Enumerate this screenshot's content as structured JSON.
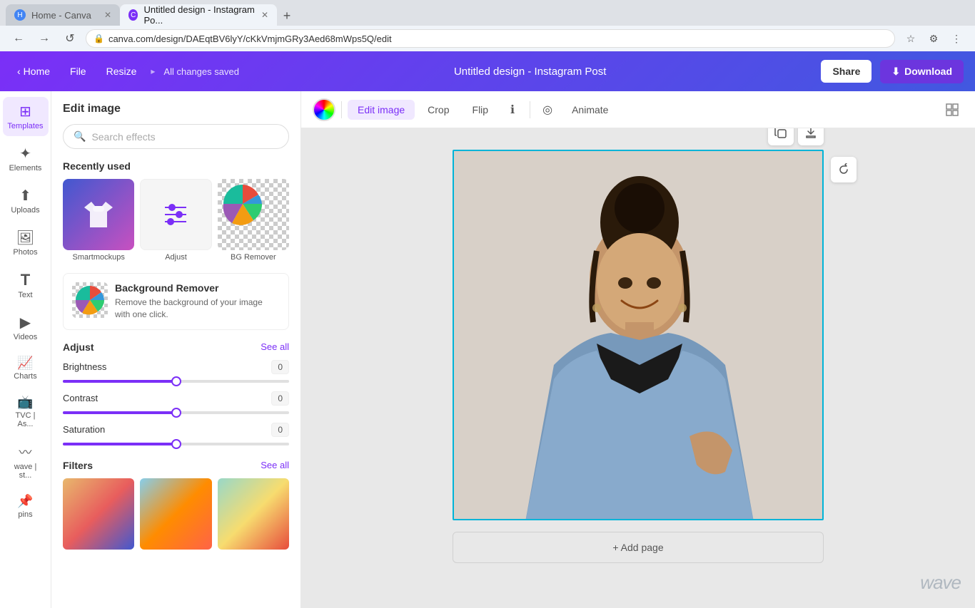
{
  "browser": {
    "tabs": [
      {
        "id": "home",
        "favicon": "H",
        "favicon_class": "home",
        "label": "Home - Canva",
        "active": false
      },
      {
        "id": "design",
        "favicon": "C",
        "favicon_class": "canva",
        "label": "Untitled design - Instagram Po...",
        "active": true
      }
    ],
    "address": "canva.com/design/DAEqtBV6lyY/cKkVmjmGRy3Aed68mWps5Q/edit",
    "new_tab_icon": "+"
  },
  "topbar": {
    "home_label": "Home",
    "file_label": "File",
    "resize_label": "Resize",
    "status_label": "All changes saved",
    "title": "Untitled design - Instagram Post",
    "share_label": "Share",
    "download_label": "Download"
  },
  "sidebar": {
    "items": [
      {
        "id": "templates",
        "icon": "⊞",
        "label": "Templates"
      },
      {
        "id": "elements",
        "icon": "✦",
        "label": "Elements"
      },
      {
        "id": "uploads",
        "icon": "↑",
        "label": "Uploads"
      },
      {
        "id": "photos",
        "icon": "🖼",
        "label": "Photos"
      },
      {
        "id": "text",
        "icon": "T",
        "label": "Text"
      },
      {
        "id": "videos",
        "icon": "▶",
        "label": "Videos"
      },
      {
        "id": "charts",
        "icon": "📈",
        "label": "Charts"
      },
      {
        "id": "tvc",
        "icon": "📺",
        "label": "TVC | As..."
      },
      {
        "id": "wave",
        "icon": "〰",
        "label": "wave | st..."
      },
      {
        "id": "pins",
        "icon": "📌",
        "label": "pins"
      }
    ]
  },
  "panel": {
    "title": "Edit image",
    "search_placeholder": "Search effects",
    "recently_used_label": "Recently used",
    "items": [
      {
        "id": "smartmockups",
        "label": "Smartmockups"
      },
      {
        "id": "adjust",
        "label": "Adjust"
      },
      {
        "id": "bgremover",
        "label": "BG Remover"
      }
    ],
    "bg_remover": {
      "title": "Background Remover",
      "description": "Remove the background of your image with one click."
    },
    "adjust": {
      "title": "Adjust",
      "see_all": "See all",
      "brightness": {
        "label": "Brightness",
        "value": "0",
        "pct": 50
      },
      "contrast": {
        "label": "Contrast",
        "value": "0",
        "pct": 50
      },
      "saturation": {
        "label": "Saturation",
        "value": "0",
        "pct": 50
      }
    },
    "filters": {
      "title": "Filters",
      "see_all": "See all"
    }
  },
  "toolbar": {
    "edit_image_tab": "Edit image",
    "crop_tab": "Crop",
    "flip_tab": "Flip",
    "info_icon": "ℹ",
    "animate_tab": "Animate"
  },
  "canvas": {
    "add_page_label": "+ Add page",
    "wave_brand": "wave"
  }
}
